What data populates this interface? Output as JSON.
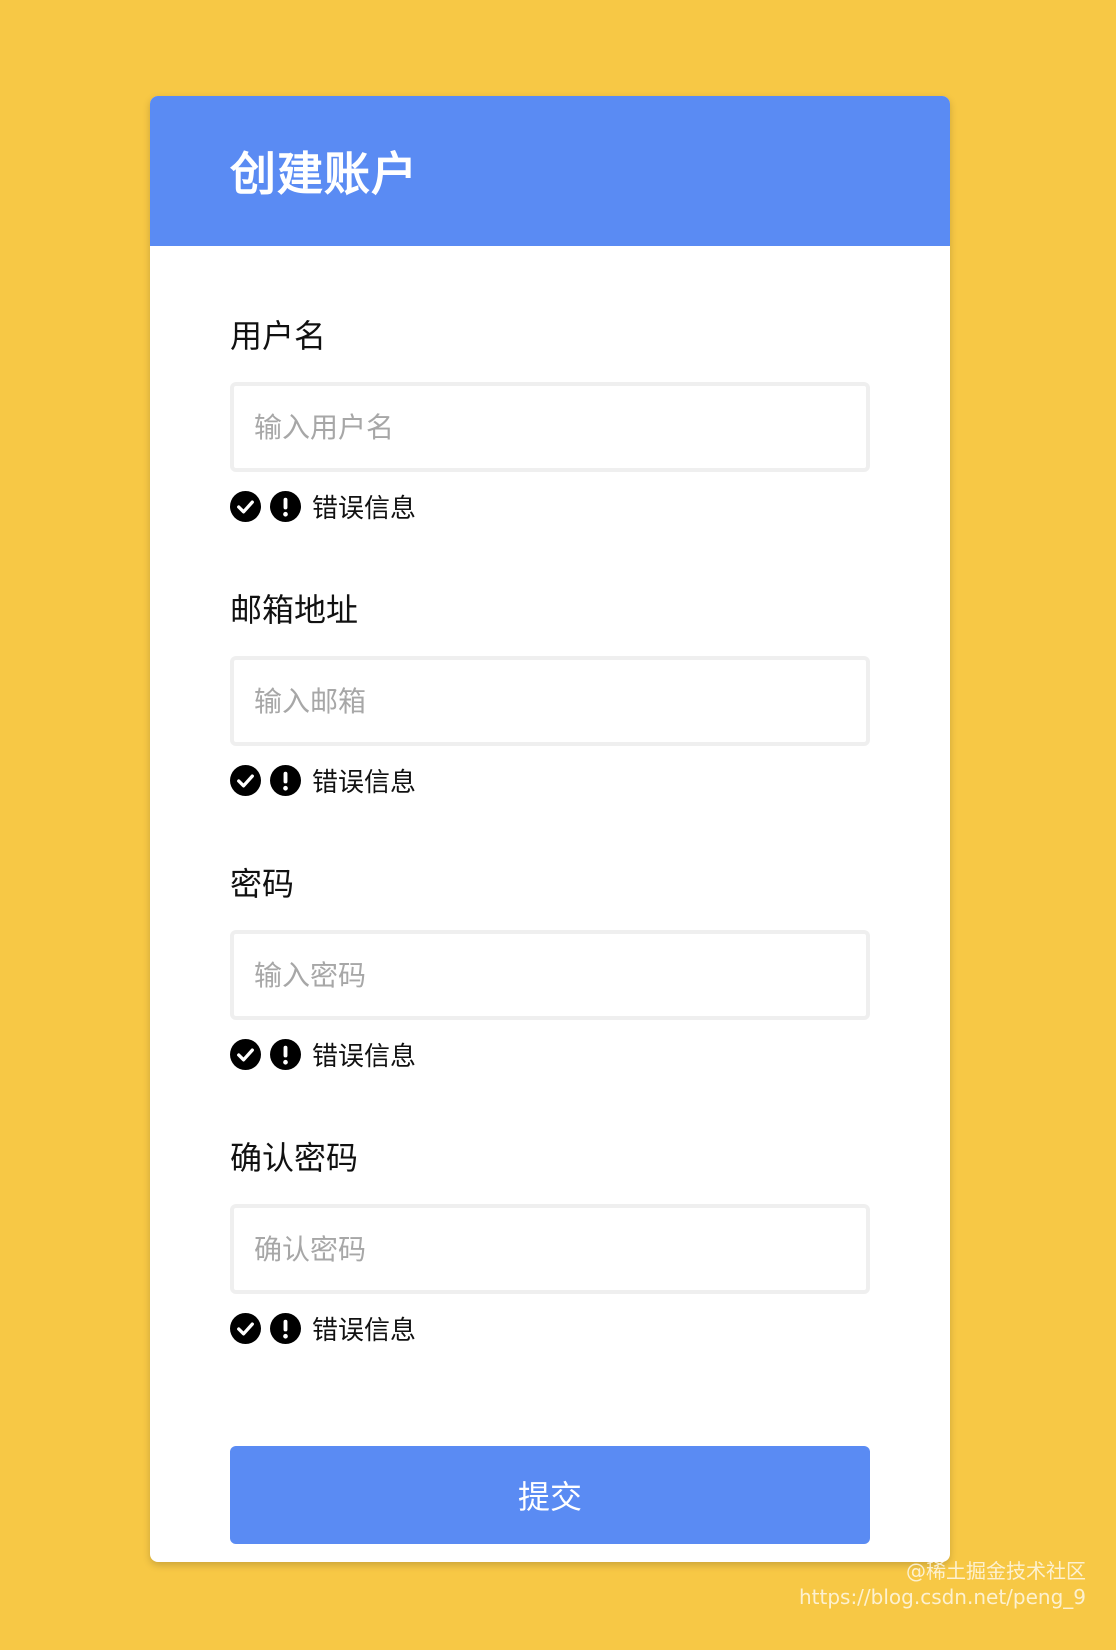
{
  "header": {
    "title": "创建账户"
  },
  "fields": [
    {
      "label": "用户名",
      "placeholder": "输入用户名",
      "value": "",
      "error": "错误信息"
    },
    {
      "label": "邮箱地址",
      "placeholder": "输入邮箱",
      "value": "",
      "error": "错误信息"
    },
    {
      "label": "密码",
      "placeholder": "输入密码",
      "value": "",
      "error": "错误信息"
    },
    {
      "label": "确认密码",
      "placeholder": "确认密码",
      "value": "",
      "error": "错误信息"
    }
  ],
  "submit": {
    "label": "提交"
  },
  "watermark": {
    "line1": "@稀土掘金技术社区",
    "line2": "https://blog.csdn.net/peng_9"
  },
  "colors": {
    "background": "#f7c845",
    "accent": "#5a8bf3",
    "card": "#ffffff"
  },
  "icons": {
    "success": "check-circle-icon",
    "error": "exclamation-circle-icon"
  }
}
